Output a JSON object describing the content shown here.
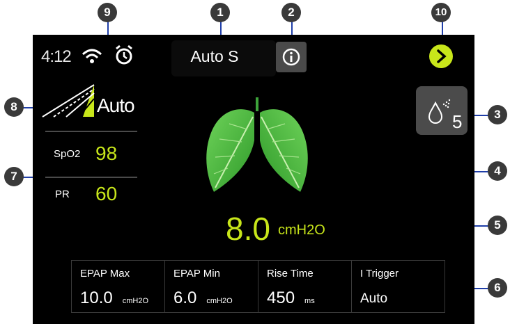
{
  "status": {
    "time": "4:12"
  },
  "header": {
    "mode": "Auto S"
  },
  "ramp": {
    "label": "Auto"
  },
  "stats": [
    {
      "label": "SpO2",
      "value": "98"
    },
    {
      "label": "PR",
      "value": "60"
    }
  ],
  "humidity": {
    "level": "5"
  },
  "pressure": {
    "value": "8.0",
    "unit": "cmH2O"
  },
  "settings": [
    {
      "label": "EPAP Max",
      "value": "10.0",
      "unit": "cmH2O"
    },
    {
      "label": "EPAP Min",
      "value": "6.0",
      "unit": "cmH2O"
    },
    {
      "label": "Rise Time",
      "value": "450",
      "unit": "ms"
    },
    {
      "label": "I Trigger",
      "value": "Auto",
      "unit": ""
    }
  ],
  "callouts": [
    "1",
    "2",
    "3",
    "4",
    "5",
    "6",
    "7",
    "8",
    "9",
    "10"
  ],
  "colors": {
    "accent": "#c8e61a",
    "background": "#000000",
    "callout": "#3a3a3a",
    "leader": "#1f3ea8"
  },
  "icons": [
    "wifi-icon",
    "alarm-clock-icon",
    "info-icon",
    "next-arrow-icon",
    "ramp-icon",
    "humidifier-icon",
    "lungs-icon"
  ]
}
